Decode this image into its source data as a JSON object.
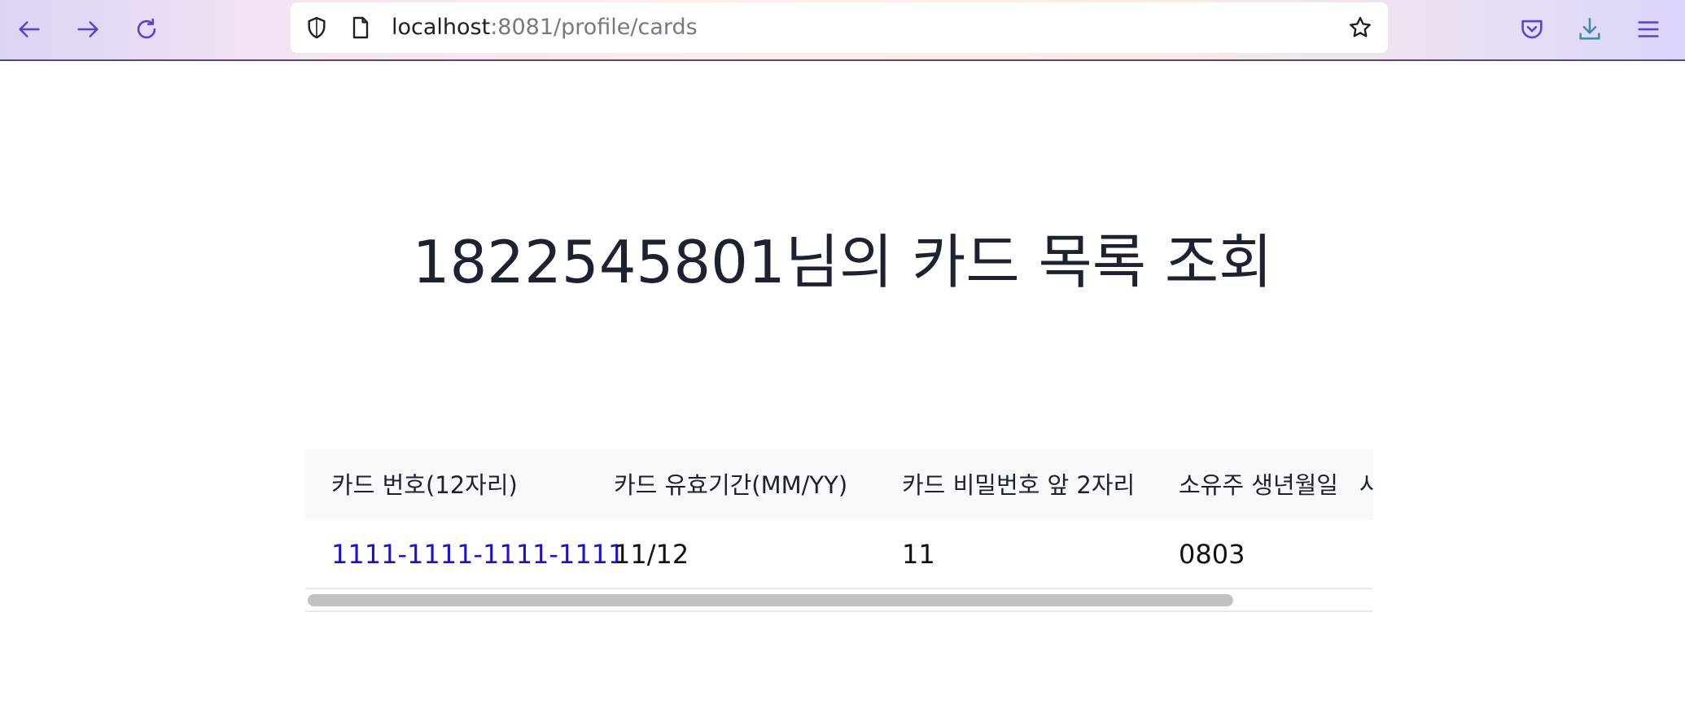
{
  "browser": {
    "url_host": "localhost",
    "url_path": ":8081/profile/cards",
    "icons": {
      "back": "arrow-left-icon",
      "forward": "arrow-right-icon",
      "reload": "reload-icon",
      "shield": "shield-icon",
      "page": "page-icon",
      "bookmark": "star-icon",
      "pocket": "pocket-icon",
      "downloads": "download-icon",
      "menu": "hamburger-menu-icon"
    },
    "accent_color": "#5b3fd6"
  },
  "page": {
    "title": "1822545801님의 카드 목록 조회"
  },
  "table": {
    "headers": [
      "카드 번호(12자리)",
      "카드 유효기간(MM/YY)",
      "카드 비밀번호 앞 2자리",
      "소유주 생년월일",
      "사"
    ],
    "rows": [
      {
        "card_number": "1111-1111-1111-1111",
        "expiry": "11/12",
        "pin_prefix": "11",
        "birth": "0803"
      }
    ],
    "link_color": "#1a12d6"
  }
}
